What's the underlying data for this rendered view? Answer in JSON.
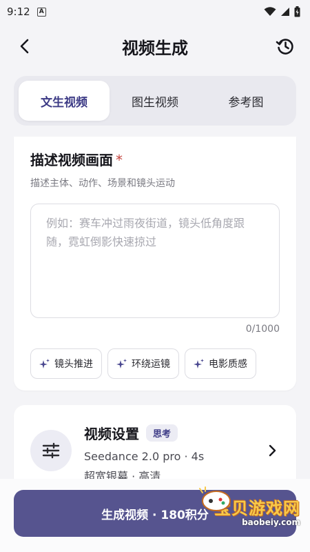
{
  "status_bar": {
    "time": "9:12",
    "notification_icon": "A"
  },
  "header": {
    "title": "视频生成",
    "back_icon": "chevron-left-icon",
    "history_icon": "history-icon"
  },
  "tabs": [
    {
      "label": "文生视频",
      "active": true
    },
    {
      "label": "图生视频",
      "active": false
    },
    {
      "label": "参考图",
      "active": false
    }
  ],
  "description": {
    "title": "描述视频画面",
    "required_mark": "*",
    "subtitle": "描述主体、动作、场景和镜头运动",
    "placeholder": "例如：赛车冲过雨夜街道，镜头低角度跟随，霓虹倒影快速掠过",
    "counter": "0/1000",
    "chips": [
      {
        "label": "镜头推进",
        "icon": "sparkle-icon"
      },
      {
        "label": "环绕运镜",
        "icon": "sparkle-icon"
      },
      {
        "label": "电影质感",
        "icon": "sparkle-icon"
      }
    ]
  },
  "settings": {
    "title": "视频设置",
    "badge": "思考",
    "line1": "Seedance 2.0 pro · 4s",
    "line2": "超宽银幕 · 高清",
    "icon": "sliders-icon"
  },
  "primary_button": {
    "label": "生成视频 · 180积分"
  },
  "watermark": {
    "text": "宝贝游戏网",
    "sub": "baobeiy.com"
  },
  "colors": {
    "accent": "#3d3b86",
    "button": "#56548f",
    "required": "#c4453e"
  }
}
